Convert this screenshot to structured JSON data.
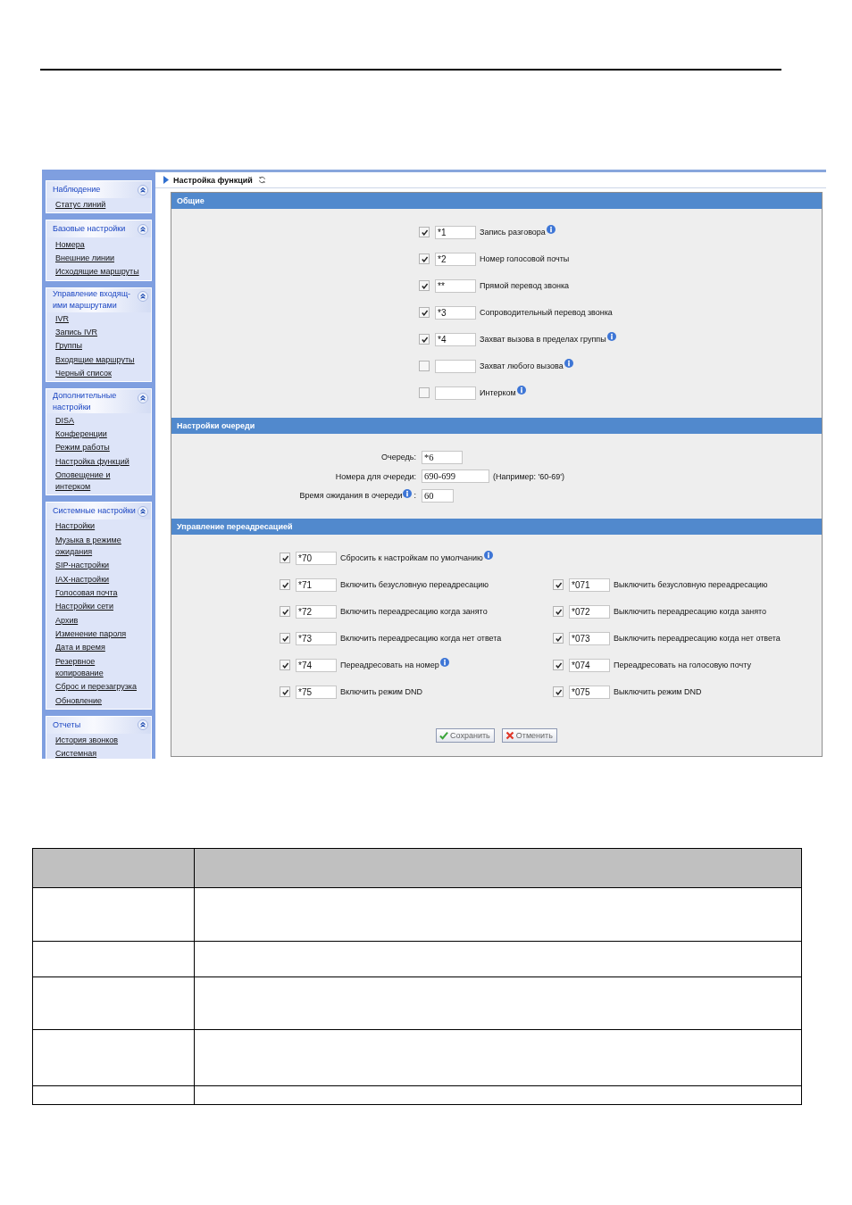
{
  "sidebar": [
    {
      "title": "Наблюдение",
      "expanded": true,
      "items": [
        "Статус линий"
      ]
    },
    {
      "title": "Базовые настройки",
      "expanded": true,
      "items": [
        "Номера",
        "Внешние линии",
        "Исходящие маршруты"
      ]
    },
    {
      "title": "Управление входящ-ими маршрутами",
      "expanded": true,
      "items": [
        "IVR",
        "Запись IVR",
        "Группы",
        "Входящие маршруты",
        "Черный список"
      ]
    },
    {
      "title": "Дополнительные настройки",
      "expanded": true,
      "items": [
        "DISA",
        "Конференции",
        "Режим работы",
        "Настройка функций",
        "Оповещение и интерком"
      ]
    },
    {
      "title": "Системные настройки",
      "expanded": true,
      "items": [
        "Настройки",
        "Музыка в режиме ожидания",
        "SIP-настройки",
        "IAX-настройки",
        "Голосовая почта",
        "Настройки сети",
        "Архив",
        "Изменение пароля",
        "Дата и время",
        "Резервное копирование",
        "Сброс и перезагрузка",
        "Обновление"
      ]
    },
    {
      "title": "Отчеты",
      "expanded": true,
      "items": [
        "История звонков",
        "Системная"
      ]
    }
  ],
  "breadcrumb": {
    "title": "Настройка функций"
  },
  "sections": [
    {
      "kind": "features",
      "title": "Общие",
      "rows": [
        {
          "checked": true,
          "code": "*1",
          "label": "Запись разговора",
          "info": true
        },
        {
          "checked": true,
          "code": "*2",
          "label": "Номер голосовой почты",
          "info": false
        },
        {
          "checked": true,
          "code": "**",
          "label": "Прямой перевод звонка",
          "info": false
        },
        {
          "checked": true,
          "code": "*3",
          "label": "Сопроводительный перевод звонка",
          "info": false
        },
        {
          "checked": true,
          "code": "*4",
          "label": "Захват вызова в пределах группы",
          "info": true
        },
        {
          "checked": false,
          "label": "Захват любого вызова",
          "info": true
        },
        {
          "checked": false,
          "label": "Интерком",
          "info": true
        }
      ]
    },
    {
      "kind": "queue",
      "title": "Настройки очереди",
      "fields": [
        {
          "label": "Очередь:",
          "value": "*6",
          "info": false
        },
        {
          "label": "Номера для очереди:",
          "value": "690-699",
          "hint": "(Например: '60-69')",
          "info": false
        },
        {
          "label": "Время ожидания в очереди",
          "info": true,
          "tail": ":",
          "value": "60"
        }
      ]
    },
    {
      "kind": "forwarding",
      "title": "Управление переадресацией",
      "rows": [
        {
          "left": {
            "checked": true,
            "code": "*70",
            "label": "Сбросить к настройкам по умолчанию",
            "info": true
          }
        },
        {
          "left": {
            "checked": true,
            "code": "*71",
            "label": "Включить безусловную переадресацию",
            "info": false
          },
          "right": {
            "checked": true,
            "code": "*071",
            "label": "Выключить безусловную переадресацию",
            "info": false
          }
        },
        {
          "left": {
            "checked": true,
            "code": "*72",
            "label": "Включить переадресацию когда занято",
            "info": false
          },
          "right": {
            "checked": true,
            "code": "*072",
            "label": "Выключить переадресацию когда занято",
            "info": false
          }
        },
        {
          "left": {
            "checked": true,
            "code": "*73",
            "label": "Включить переадресацию когда нет ответа",
            "info": false
          },
          "right": {
            "checked": true,
            "code": "*073",
            "label": "Выключить переадресацию когда нет ответа",
            "info": false
          }
        },
        {
          "left": {
            "checked": true,
            "code": "*74",
            "label": "Переадресовать на номер",
            "info": true
          },
          "right": {
            "checked": true,
            "code": "*074",
            "label": "Переадресовать на голосовую почту",
            "info": false
          }
        },
        {
          "left": {
            "checked": true,
            "code": "*75",
            "label": "Включить режим DND",
            "info": false
          },
          "right": {
            "checked": true,
            "code": "*075",
            "label": "Выключить режим DND",
            "info": false
          }
        }
      ]
    }
  ],
  "buttons": [
    {
      "kind": "save",
      "label": "Сохранить"
    },
    {
      "kind": "cancel",
      "label": "Отменить"
    }
  ]
}
